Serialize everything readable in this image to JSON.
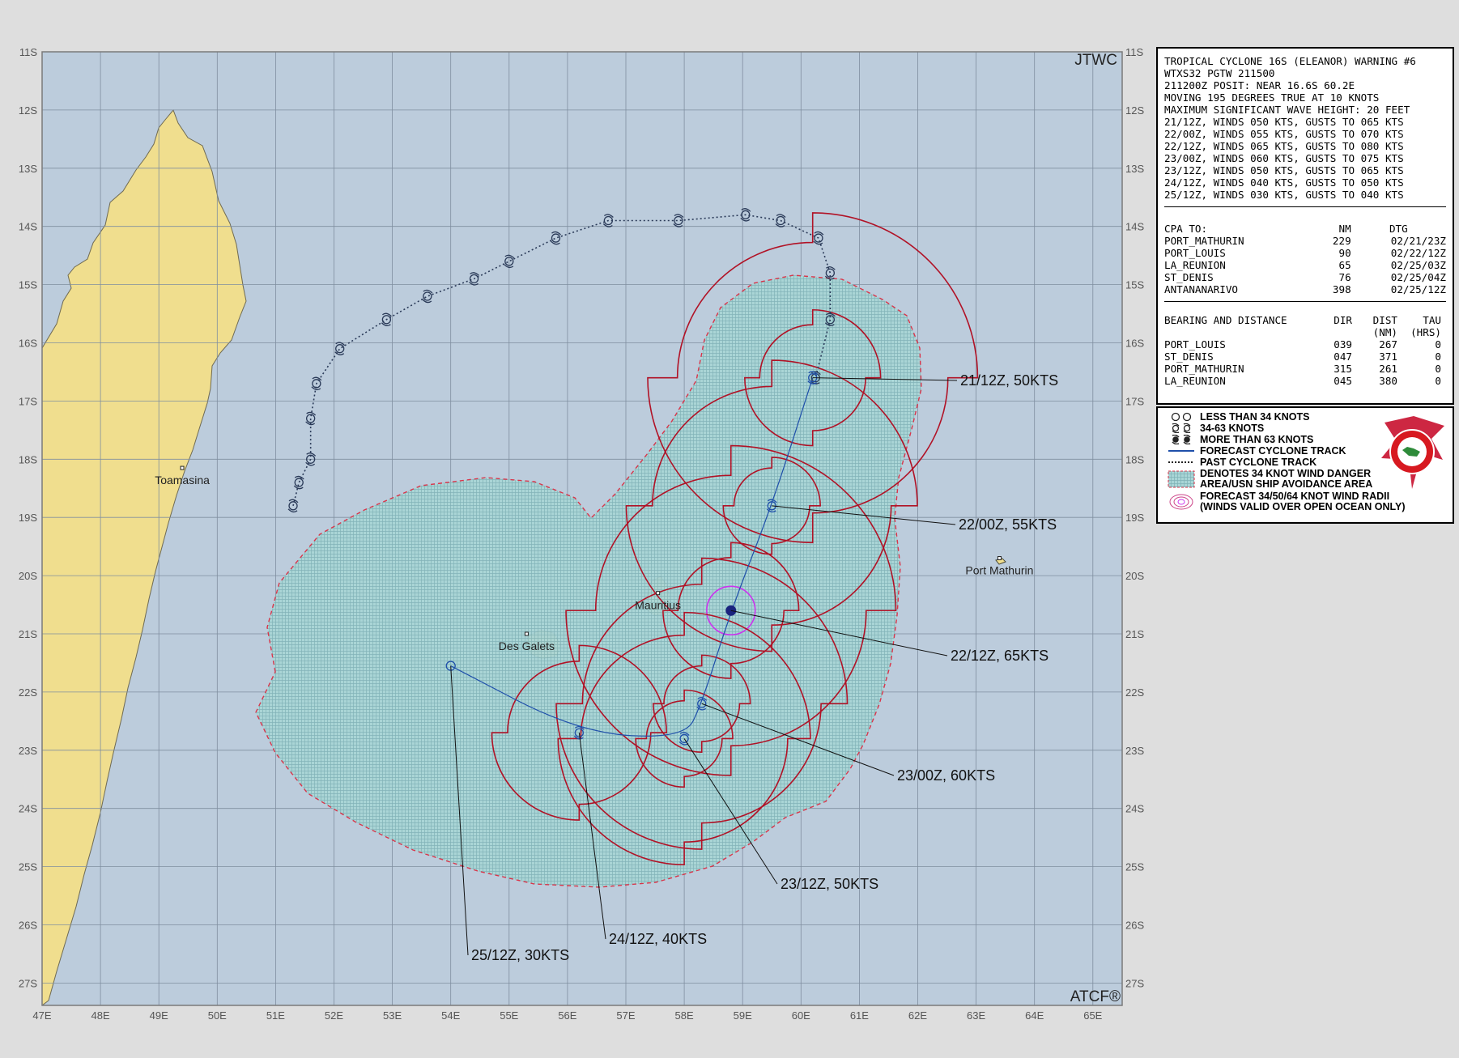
{
  "map": {
    "agency_label": "JTWC",
    "software_label": "ATCF®",
    "lon_labels": [
      "47E",
      "48E",
      "49E",
      "50E",
      "51E",
      "52E",
      "53E",
      "54E",
      "55E",
      "56E",
      "57E",
      "58E",
      "59E",
      "60E",
      "61E",
      "62E",
      "63E",
      "64E",
      "65E"
    ],
    "lat_labels": [
      "11S",
      "12S",
      "13S",
      "14S",
      "15S",
      "16S",
      "17S",
      "18S",
      "19S",
      "20S",
      "21S",
      "22S",
      "23S",
      "24S",
      "25S",
      "26S",
      "27S"
    ],
    "places": [
      {
        "name": "Toamasina",
        "lon": 49.4,
        "lat": -18.15
      },
      {
        "name": "Mauritius",
        "lon": 57.55,
        "lat": -20.3
      },
      {
        "name": "Des Galets",
        "lon": 55.3,
        "lat": -21.0
      },
      {
        "name": "Port Mathurin",
        "lon": 63.4,
        "lat": -19.7
      }
    ],
    "past_track": [
      {
        "lon": 51.3,
        "lat": -18.8
      },
      {
        "lon": 51.4,
        "lat": -18.4
      },
      {
        "lon": 51.6,
        "lat": -18.0
      },
      {
        "lon": 51.6,
        "lat": -17.3
      },
      {
        "lon": 51.7,
        "lat": -16.7
      },
      {
        "lon": 52.1,
        "lat": -16.1
      },
      {
        "lon": 52.9,
        "lat": -15.6
      },
      {
        "lon": 53.6,
        "lat": -15.2
      },
      {
        "lon": 54.4,
        "lat": -14.9
      },
      {
        "lon": 55.0,
        "lat": -14.6
      },
      {
        "lon": 55.8,
        "lat": -14.2
      },
      {
        "lon": 56.7,
        "lat": -13.9
      },
      {
        "lon": 57.9,
        "lat": -13.9
      },
      {
        "lon": 59.05,
        "lat": -13.8
      },
      {
        "lon": 59.65,
        "lat": -13.9
      },
      {
        "lon": 60.3,
        "lat": -14.2
      },
      {
        "lon": 60.5,
        "lat": -14.8
      },
      {
        "lon": 60.5,
        "lat": -15.6
      },
      {
        "lon": 60.25,
        "lat": -16.6
      }
    ],
    "forecast_points": [
      {
        "label": "21/12Z, 50KTS",
        "lon": 60.2,
        "lat": -16.6,
        "r34_nm": 170,
        "r50_nm": 70,
        "r64_nm": 0
      },
      {
        "label": "22/00Z, 55KTS",
        "lon": 59.5,
        "lat": -18.8,
        "r34_nm": 150,
        "r50_nm": 50,
        "r64_nm": 0
      },
      {
        "label": "22/12Z, 65KTS",
        "lon": 58.8,
        "lat": -20.6,
        "r34_nm": 170,
        "r50_nm": 70,
        "r64_nm": 25
      },
      {
        "label": "23/00Z, 60KTS",
        "lon": 58.3,
        "lat": -22.2,
        "r34_nm": 150,
        "r50_nm": 50,
        "r64_nm": 0
      },
      {
        "label": "23/12Z, 50KTS",
        "lon": 58.0,
        "lat": -22.8,
        "r34_nm": 130,
        "r50_nm": 50,
        "r64_nm": 0
      },
      {
        "label": "24/12Z, 40KTS",
        "lon": 56.2,
        "lat": -22.7,
        "r34_nm": 90,
        "r50_nm": 0,
        "r64_nm": 0
      },
      {
        "label": "25/12Z, 30KTS",
        "lon": 54.0,
        "lat": -21.55,
        "r34_nm": 0,
        "r50_nm": 0,
        "r64_nm": 0
      }
    ],
    "colors": {
      "ocean": "#bcccdc",
      "land": "#f0de8e",
      "grid": "#7f8e9f",
      "danger_area": "#a4d3d4",
      "danger_border": "#d9354a",
      "wind_radii": "#b11226",
      "track": "#1f4faa",
      "past_track": "#2a3a58",
      "r64": "#cc33ee",
      "current_fill": "#1a237e"
    }
  },
  "warning": {
    "title": "TROPICAL CYCLONE 16S (ELEANOR) WARNING #6",
    "header_lines": [
      "WTXS32 PGTW 211500",
      "211200Z POSIT: NEAR 16.6S 60.2E",
      "MOVING 195 DEGREES TRUE AT 10 KNOTS",
      "MAXIMUM SIGNIFICANT WAVE HEIGHT: 20 FEET"
    ],
    "forecast_lines": [
      "21/12Z, WINDS 050 KTS, GUSTS TO 065 KTS",
      "22/00Z, WINDS 055 KTS, GUSTS TO 070 KTS",
      "22/12Z, WINDS 065 KTS, GUSTS TO 080 KTS",
      "23/00Z, WINDS 060 KTS, GUSTS TO 075 KTS",
      "23/12Z, WINDS 050 KTS, GUSTS TO 065 KTS",
      "24/12Z, WINDS 040 KTS, GUSTS TO 050 KTS",
      "25/12Z, WINDS 030 KTS, GUSTS TO 040 KTS"
    ],
    "cpa": {
      "header": {
        "name": "CPA TO:",
        "nm": "NM",
        "dtg": "DTG"
      },
      "rows": [
        {
          "name": "PORT_MATHURIN",
          "nm": "229",
          "dtg": "02/21/23Z"
        },
        {
          "name": "PORT_LOUIS",
          "nm": "90",
          "dtg": "02/22/12Z"
        },
        {
          "name": "LA_REUNION",
          "nm": "65",
          "dtg": "02/25/03Z"
        },
        {
          "name": "ST_DENIS",
          "nm": "76",
          "dtg": "02/25/04Z"
        },
        {
          "name": "ANTANANARIVO",
          "nm": "398",
          "dtg": "02/25/12Z"
        }
      ]
    },
    "bearing": {
      "header": {
        "name": "BEARING AND DISTANCE",
        "dir": "DIR",
        "dist": "DIST",
        "tau": "TAU",
        "dist_unit": "(NM)",
        "tau_unit": "(HRS)"
      },
      "rows": [
        {
          "name": "PORT_LOUIS",
          "dir": "039",
          "dist": "267",
          "tau": "0"
        },
        {
          "name": "ST_DENIS",
          "dir": "047",
          "dist": "371",
          "tau": "0"
        },
        {
          "name": "PORT_MATHURIN",
          "dir": "315",
          "dist": "261",
          "tau": "0"
        },
        {
          "name": "LA_REUNION",
          "dir": "045",
          "dist": "380",
          "tau": "0"
        }
      ]
    }
  },
  "legend": {
    "items": [
      "LESS THAN 34 KNOTS",
      "34-63 KNOTS",
      "MORE THAN 63 KNOTS",
      "FORECAST CYCLONE TRACK",
      "PAST CYCLONE TRACK"
    ],
    "danger_line1": "DENOTES 34 KNOT WIND DANGER",
    "danger_line2": "AREA/USN SHIP AVOIDANCE AREA",
    "radii_line1": "FORECAST 34/50/64 KNOT WIND RADII",
    "radii_line2": "(WINDS VALID OVER OPEN OCEAN ONLY)",
    "seal_icon": "jtwc-seal-icon"
  }
}
